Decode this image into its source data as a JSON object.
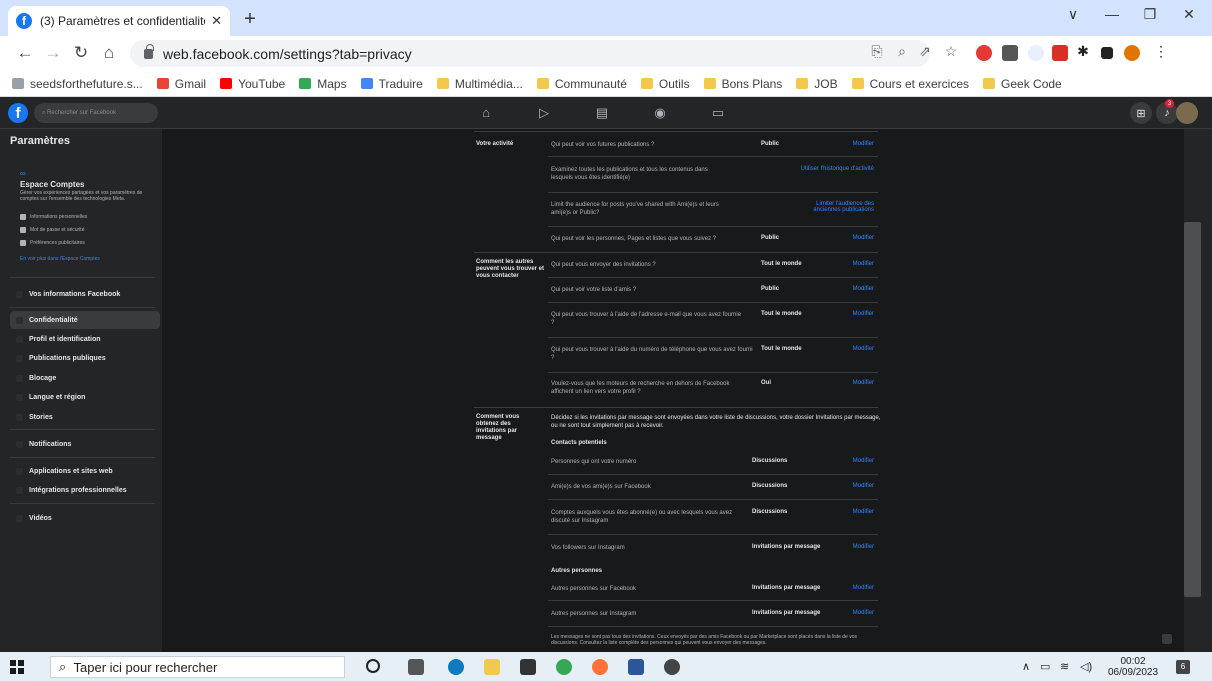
{
  "browser": {
    "tab_title": "(3) Paramètres et confidentialité |",
    "tab_close": "✕",
    "new_tab": "+",
    "url": "web.facebook.com/settings?tab=privacy",
    "window_controls": [
      "∨",
      "—",
      "❐",
      "✕"
    ]
  },
  "bookmarks": [
    {
      "label": "seedsforthefuture.s...",
      "color": "#9aa0a6"
    },
    {
      "label": "Gmail",
      "color": "#ea4335"
    },
    {
      "label": "YouTube",
      "color": "#ff0000"
    },
    {
      "label": "Maps",
      "color": "#34a853"
    },
    {
      "label": "Traduire",
      "color": "#4285f4"
    },
    {
      "label": "Multimédia...",
      "folder": true
    },
    {
      "label": "Communauté",
      "folder": true
    },
    {
      "label": "Outils",
      "folder": true
    },
    {
      "label": "Bons Plans",
      "folder": true
    },
    {
      "label": "JOB",
      "folder": true
    },
    {
      "label": "Cours et exercices",
      "folder": true
    },
    {
      "label": "Geek Code",
      "folder": true
    }
  ],
  "fb": {
    "search_placeholder": "Rechercher sur Facebook",
    "notif_count": "3"
  },
  "sidebar": {
    "title": "Paramètres",
    "meta_icon": "∞",
    "accounts_title": "Espace Comptes",
    "accounts_desc": "Gérer vos expériences partagées et vos paramètres de comptes sur l'ensemble des technologies Meta.",
    "sub_items": [
      "Informations personnelles",
      "Mot de passe et sécurité",
      "Préférences publicitaires"
    ],
    "accounts_link": "En voir plus dans l'Espace Comptes",
    "items": [
      "Vos informations Facebook",
      "Confidentialité",
      "Profil et identification",
      "Publications publiques",
      "Blocage",
      "Langue et région",
      "Stories",
      "Notifications",
      "Applications et sites web",
      "Intégrations professionnelles",
      "Vidéos"
    ]
  },
  "content": {
    "section_activity": "Votre activité",
    "section_find": "Comment les autres peuvent vous trouver et vous contacter",
    "section_invites": "Comment vous obtenez des invitations par message",
    "rows": [
      {
        "q": "Qui peut voir vos futures publications ?",
        "v": "Public",
        "m": "Modifier"
      },
      {
        "q": "Examinez toutes les publications et tous les contenus dans lesquels vous êtes identifié(e)",
        "v": "",
        "m": "Utiliser l'historique d'activité"
      },
      {
        "q": "Limit the audience for posts you've shared with Ami(e)s et leurs ami(e)s or Public?",
        "v": "",
        "m": "Limiter l'audience des anciennes publications"
      },
      {
        "q": "Qui peut voir les personnes, Pages et listes que vous suivez ?",
        "v": "Public",
        "m": "Modifier"
      },
      {
        "q": "Qui peut vous envoyer des invitations ?",
        "v": "Tout le monde",
        "m": "Modifier"
      },
      {
        "q": "Qui peut voir votre liste d'amis ?",
        "v": "Public",
        "m": "Modifier"
      },
      {
        "q": "Qui peut vous trouver à l'aide de l'adresse e-mail que vous avez fournie ?",
        "v": "Tout le monde",
        "m": "Modifier"
      },
      {
        "q": "Qui peut vous trouver à l'aide du numéro de téléphone que vous avez fourni ?",
        "v": "Tout le monde",
        "m": "Modifier"
      },
      {
        "q": "Voulez-vous que les moteurs de recherche en dehors de Facebook affichent un lien vers votre profil ?",
        "v": "Oui",
        "m": "Modifier"
      }
    ],
    "invites_intro": "Décidez si les invitations par message sont envoyées dans votre liste de discussions, votre dossier Invitations par message, ou ne sont tout simplement pas à recevoir.",
    "potential_title": "Contacts potentiels",
    "potential_rows": [
      {
        "q": "Personnes qui ont votre numéro",
        "v": "Discussions",
        "m": "Modifier"
      },
      {
        "q": "Ami(e)s de vos ami(e)s sur Facebook",
        "v": "Discussions",
        "m": "Modifier"
      },
      {
        "q": "Comptes auxquels vous êtes abonné(e) ou avec lesquels vous avez discuté sur Instagram",
        "v": "Discussions",
        "m": "Modifier"
      },
      {
        "q": "Vos followers sur Instagram",
        "v": "Invitations par message",
        "m": "Modifier"
      }
    ],
    "others_title": "Autres personnes",
    "others_rows": [
      {
        "q": "Autres personnes sur Facebook",
        "v": "Invitations par message",
        "m": "Modifier"
      },
      {
        "q": "Autres personnes sur Instagram",
        "v": "Invitations par message",
        "m": "Modifier"
      }
    ],
    "footer_note": "Les messages ne sont pas tous des invitations. Ceux envoyés par des amis Facebook ou par Marketplace sont placés dans la liste de vos discussions. Consultez la liste complète des personnes qui peuvent vous envoyer des messages."
  },
  "taskbar": {
    "search_placeholder": "Taper ici pour rechercher",
    "time": "00:02",
    "date": "06/09/2023",
    "notif": "6"
  }
}
